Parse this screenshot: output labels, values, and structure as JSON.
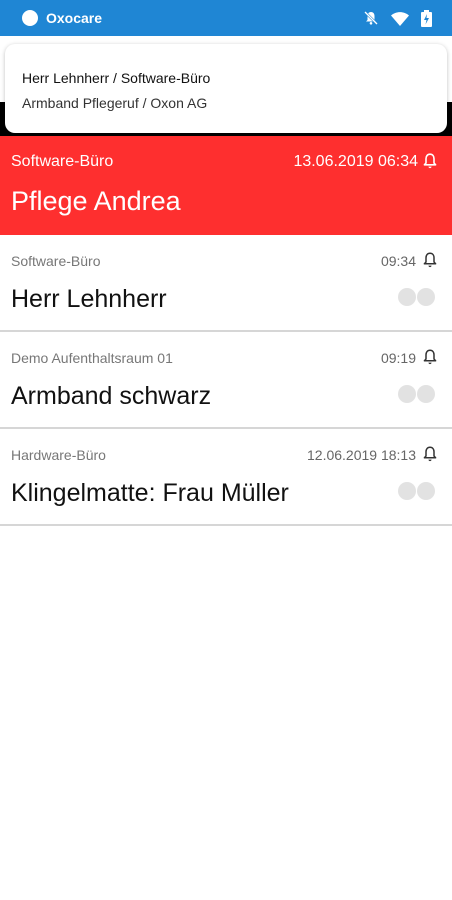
{
  "status_bar": {
    "app_name": "Oxocare",
    "icons": [
      "notifications-off-icon",
      "wifi-icon",
      "battery-icon"
    ]
  },
  "notification": {
    "title": "Herr Lehnherr / Software-Büro",
    "subtitle": "Armband Pflegeruf / Oxon AG"
  },
  "active_alarm": {
    "location": "Software-Büro",
    "time": "13.06.2019 06:34",
    "name": "Pflege Andrea",
    "icon": "bell-icon",
    "color": "#fe2f2f"
  },
  "calls": [
    {
      "location": "Software-Büro",
      "time": "09:34",
      "name": "Herr Lehnherr"
    },
    {
      "location": "Demo Aufenthaltsraum 01",
      "time": "09:19",
      "name": "Armband schwarz"
    },
    {
      "location": "Hardware-Büro",
      "time": "12.06.2019 18:13",
      "name": "Klingelmatte: Frau Müller"
    }
  ],
  "colors": {
    "status_bar": "#1f86d4",
    "alarm": "#fe2f2f",
    "divider": "#d6d6d6"
  }
}
